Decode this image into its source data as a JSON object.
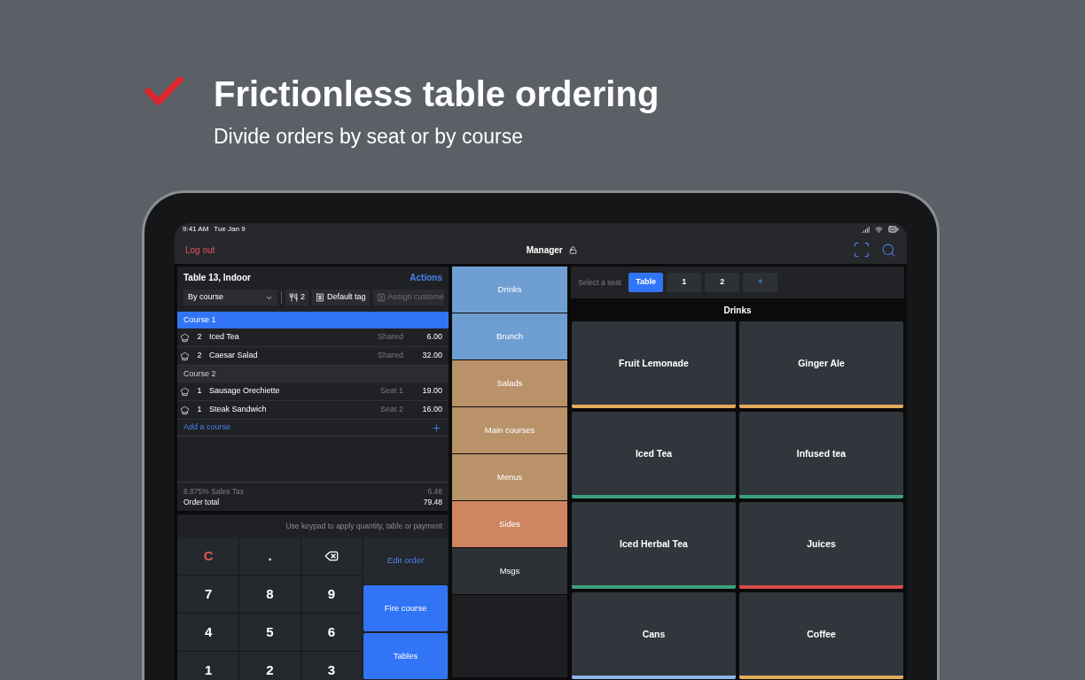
{
  "headline": {
    "title": "Frictionless table ordering",
    "subtitle": "Divide orders by seat or by course"
  },
  "status_bar": {
    "time": "9:41 AM",
    "date": "Tue Jan 9"
  },
  "top_bar": {
    "logout": "Log out",
    "user": "Manager"
  },
  "order": {
    "title": "Table 13, Indoor",
    "actions": "Actions",
    "grouping": "By course",
    "guests": "2",
    "tag": "Default tag",
    "customer": "Assign custome",
    "courses": [
      {
        "name": "Course 1",
        "selected": true,
        "items": [
          {
            "qty": "2",
            "name": "Iced Tea",
            "seat": "Shared",
            "price": "6.00"
          },
          {
            "qty": "2",
            "name": "Caesar Salad",
            "seat": "Shared",
            "price": "32.00"
          }
        ]
      },
      {
        "name": "Course 2",
        "selected": false,
        "items": [
          {
            "qty": "1",
            "name": "Sausage Orechiette",
            "seat": "Seat 1",
            "price": "19.00"
          },
          {
            "qty": "1",
            "name": "Steak Sandwich",
            "seat": "Seat 2",
            "price": "16.00"
          }
        ]
      }
    ],
    "add_course": "Add a course",
    "tax_label": "8.875% Sales Tax",
    "tax": "6.48",
    "total_label": "Order total",
    "total": "79.48"
  },
  "keypad": {
    "hint": "Use keypad to apply quantity, table or payment",
    "keys": [
      {
        "kind": "clear",
        "label": "C"
      },
      {
        "kind": "digit",
        "label": "."
      },
      {
        "kind": "backspace"
      },
      {
        "kind": "digit",
        "label": "7"
      },
      {
        "kind": "digit",
        "label": "8"
      },
      {
        "kind": "digit",
        "label": "9"
      },
      {
        "kind": "digit",
        "label": "4"
      },
      {
        "kind": "digit",
        "label": "5"
      },
      {
        "kind": "digit",
        "label": "6"
      },
      {
        "kind": "digit",
        "label": "1"
      },
      {
        "kind": "digit",
        "label": "2"
      },
      {
        "kind": "digit",
        "label": "3"
      }
    ],
    "actions": [
      {
        "kind": "secondary",
        "label": "Edit order"
      },
      {
        "kind": "primary",
        "label": "Fire course"
      },
      {
        "kind": "primary",
        "label": "Tables"
      }
    ]
  },
  "categories": [
    {
      "label": "Drinks",
      "color": "#6f9fd2"
    },
    {
      "label": "Brunch",
      "color": "#6f9fd2"
    },
    {
      "label": "Salads",
      "color": "#b9926a"
    },
    {
      "label": "Main courses",
      "color": "#b9926a"
    },
    {
      "label": "Menus",
      "color": "#b9926a"
    },
    {
      "label": "Sides",
      "color": "#cf8560"
    },
    {
      "label": "Msgs",
      "color": "#2d3035"
    }
  ],
  "seats": {
    "label": "Select a seat",
    "options": [
      {
        "label": "Table",
        "selected": true
      },
      {
        "label": "1",
        "selected": false
      },
      {
        "label": "2",
        "selected": false
      },
      {
        "label": "+",
        "selected": false
      }
    ]
  },
  "menu": {
    "title": "Drinks",
    "items": [
      {
        "label": "Fruit Lemonade",
        "color": "#e3ab5b"
      },
      {
        "label": "Ginger Ale",
        "color": "#e3ab5b"
      },
      {
        "label": "Iced Tea",
        "color": "#3ba07e"
      },
      {
        "label": "Infused tea",
        "color": "#3ba07e"
      },
      {
        "label": "Iced Herbal Tea",
        "color": "#3ba07e"
      },
      {
        "label": "Juices",
        "color": "#d84a4a"
      },
      {
        "label": "Cans",
        "color": "#8cb6e8"
      },
      {
        "label": "Coffee",
        "color": "#e3ab5b"
      }
    ]
  }
}
